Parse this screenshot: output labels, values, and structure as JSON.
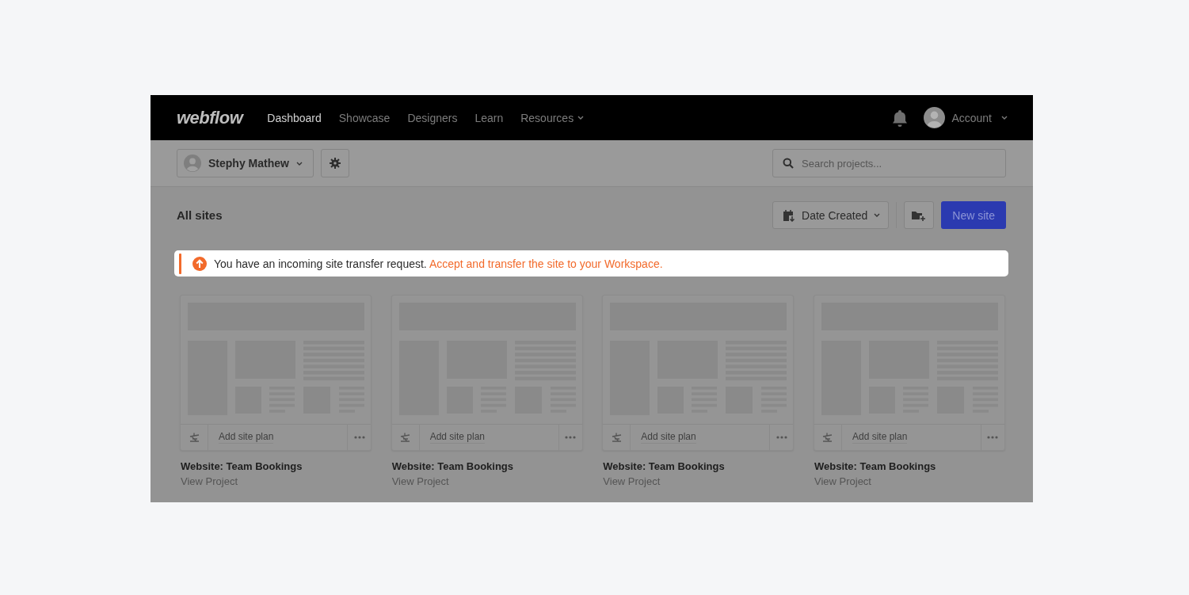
{
  "nav": {
    "logo": "webflow",
    "items": [
      {
        "label": "Dashboard",
        "selected": true,
        "has_menu": false
      },
      {
        "label": "Showcase",
        "selected": false,
        "has_menu": false
      },
      {
        "label": "Designers",
        "selected": false,
        "has_menu": false
      },
      {
        "label": "Learn",
        "selected": false,
        "has_menu": false
      },
      {
        "label": "Resources",
        "selected": false,
        "has_menu": true
      }
    ],
    "account": {
      "label": "Account"
    }
  },
  "toolbar": {
    "workspace": "Stephy Mathew",
    "search": {
      "placeholder": "Search projects..."
    }
  },
  "header": {
    "title": "All sites",
    "sort": "Date Created",
    "new_button": "New site"
  },
  "banner": {
    "message": "You have an incoming site transfer request.",
    "link": "Accept and transfer the site to your Workspace."
  },
  "sites": [
    {
      "title": "Website: Team Bookings",
      "action": "Add site plan",
      "link": "View Project"
    },
    {
      "title": "Website: Team Bookings",
      "action": "Add site plan",
      "link": "View Project"
    },
    {
      "title": "Website: Team Bookings",
      "action": "Add site plan",
      "link": "View Project"
    },
    {
      "title": "Website: Team Bookings",
      "action": "Add site plan",
      "link": "View Project"
    }
  ]
}
